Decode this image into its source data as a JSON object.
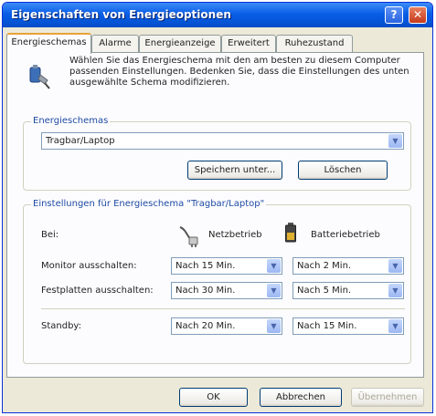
{
  "window": {
    "title": "Eigenschaften von Energieoptionen",
    "help_label": "?",
    "close_label": "✕"
  },
  "tabs": [
    {
      "label": "Energieschemas",
      "active": true
    },
    {
      "label": "Alarme",
      "active": false
    },
    {
      "label": "Energieanzeige",
      "active": false
    },
    {
      "label": "Erweitert",
      "active": false
    },
    {
      "label": "Ruhezustand",
      "active": false
    }
  ],
  "intro_text": "Wählen Sie das Energieschema mit den am besten zu diesem Computer passenden Einstellungen. Bedenken Sie, dass die Einstellungen des unten ausgewählte Schema modifizieren.",
  "schemes_group": {
    "legend": "Energieschemas",
    "selected": "Tragbar/Laptop",
    "save_label": "Speichern unter...",
    "delete_label": "Löschen"
  },
  "settings_group": {
    "legend": "Einstellungen für Energieschema \"Tragbar/Laptop\"",
    "bei_label": "Bei:",
    "ac_label": "Netzbetrieb",
    "battery_label": "Batteriebetrieb",
    "rows": [
      {
        "label": "Monitor ausschalten:",
        "ac": "Nach 15 Min.",
        "dc": "Nach 2 Min."
      },
      {
        "label": "Festplatten ausschalten:",
        "ac": "Nach 30 Min.",
        "dc": "Nach 5 Min."
      },
      {
        "label": "Standby:",
        "ac": "Nach 20 Min.",
        "dc": "Nach 15 Min."
      }
    ]
  },
  "footer": {
    "ok_label": "OK",
    "cancel_label": "Abbrechen",
    "apply_label": "Übernehmen"
  },
  "colors": {
    "titlebar": "#0a5ee6",
    "dialog_bg": "#ece9d8",
    "group_legend": "#1f4ba3",
    "tab_highlight": "#e9a23a"
  }
}
